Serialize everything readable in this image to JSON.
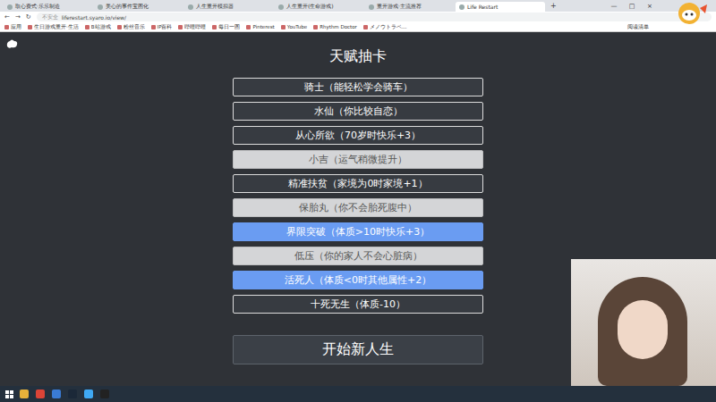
{
  "browser": {
    "tabs": [
      {
        "label": "取心费式·乐乐制造",
        "selected": false
      },
      {
        "label": "美心的事件宝图化",
        "selected": false
      },
      {
        "label": "人生重开模拟器",
        "selected": false
      },
      {
        "label": "人生重开(生命游戏)",
        "selected": false
      },
      {
        "label": "重开游戏·主流推荐",
        "selected": false
      },
      {
        "label": "Life Restart",
        "selected": true
      }
    ],
    "new_tab": "+",
    "window_controls": [
      "—",
      "□",
      "×"
    ],
    "nav": [
      "←",
      "→",
      "↻"
    ],
    "address": {
      "security": "不安全",
      "url": "liferestart.syaro.io/view/"
    },
    "bookmarks": [
      "应用",
      "生日游戏重开·生活",
      "B站游戏",
      "粉丝音乐",
      "IP百科",
      "哔哩哔哩",
      "每日一图",
      "Pinterest",
      "YouTube",
      "Rhythm Doctor",
      "メノウトラベ…"
    ],
    "reading_list": "阅读清单"
  },
  "page": {
    "title": "天赋抽卡",
    "talents": [
      {
        "label": "骑士（能轻松学会骑车）",
        "kind": "common",
        "selected": false
      },
      {
        "label": "水仙（你比较自恋）",
        "kind": "common",
        "selected": false
      },
      {
        "label": "从心所欲（70岁时快乐+3）",
        "kind": "common",
        "selected": false
      },
      {
        "label": "小吉（运气稍微提升）",
        "kind": "common",
        "selected": true
      },
      {
        "label": "精准扶贫（家境为0时家境+1）",
        "kind": "common",
        "selected": false
      },
      {
        "label": "保胎丸（你不会胎死腹中）",
        "kind": "common",
        "selected": true
      },
      {
        "label": "界限突破（体质>10时快乐+3）",
        "kind": "rare",
        "selected": false
      },
      {
        "label": "低压（你的家人不会心脏病）",
        "kind": "common",
        "selected": true
      },
      {
        "label": "活死人（体质<0时其他属性+2）",
        "kind": "rare",
        "selected": false
      },
      {
        "label": "十死无生（体质-10）",
        "kind": "common",
        "selected": false
      }
    ],
    "start_button": "开始新人生"
  }
}
